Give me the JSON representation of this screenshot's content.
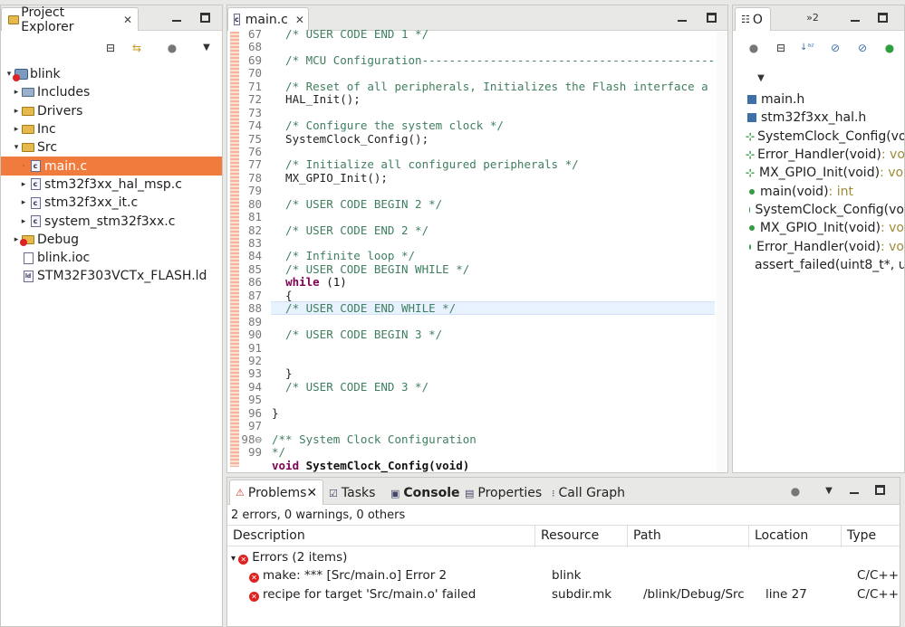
{
  "project_explorer": {
    "tab_label": "Project Explorer",
    "tree": [
      {
        "label": "blink",
        "indent": 0,
        "twisty": "▾",
        "kind": "project"
      },
      {
        "label": "Includes",
        "indent": 1,
        "twisty": "▸",
        "kind": "includes"
      },
      {
        "label": "Drivers",
        "indent": 1,
        "twisty": "▸",
        "kind": "folder"
      },
      {
        "label": "Inc",
        "indent": 1,
        "twisty": "▸",
        "kind": "folder"
      },
      {
        "label": "Src",
        "indent": 1,
        "twisty": "▾",
        "kind": "folder"
      },
      {
        "label": "main.c",
        "indent": 2,
        "twisty": "·",
        "kind": "cfile",
        "selected": true
      },
      {
        "label": "stm32f3xx_hal_msp.c",
        "indent": 2,
        "twisty": "▸",
        "kind": "cfile"
      },
      {
        "label": "stm32f3xx_it.c",
        "indent": 2,
        "twisty": "▸",
        "kind": "cfile"
      },
      {
        "label": "system_stm32f3xx.c",
        "indent": 2,
        "twisty": "▸",
        "kind": "cfile"
      },
      {
        "label": "Debug",
        "indent": 1,
        "twisty": "▸",
        "kind": "folder-error"
      },
      {
        "label": "blink.ioc",
        "indent": 1,
        "twisty": "",
        "kind": "file"
      },
      {
        "label": "STM32F303VCTx_FLASH.ld",
        "indent": 1,
        "twisty": "",
        "kind": "ldfile"
      }
    ]
  },
  "editor": {
    "tab_label": "main.c",
    "lines": [
      {
        "n": "67",
        "t": "  /* USER CODE END 1 */",
        "c": "cmt"
      },
      {
        "n": "68",
        "t": "",
        "c": ""
      },
      {
        "n": "69",
        "t": "  /* MCU Configuration----------------------------------------------",
        "c": "cmt"
      },
      {
        "n": "70",
        "t": "",
        "c": ""
      },
      {
        "n": "71",
        "t": "  /* Reset of all peripherals, Initializes the Flash interface a",
        "c": "cmt"
      },
      {
        "n": "72",
        "t": "  HAL_Init();",
        "c": ""
      },
      {
        "n": "73",
        "t": "",
        "c": ""
      },
      {
        "n": "74",
        "t": "  /* Configure the system clock */",
        "c": "cmt"
      },
      {
        "n": "75",
        "t": "  SystemClock_Config();",
        "c": ""
      },
      {
        "n": "76",
        "t": "",
        "c": ""
      },
      {
        "n": "77",
        "t": "  /* Initialize all configured peripherals */",
        "c": "cmt"
      },
      {
        "n": "78",
        "t": "  MX_GPIO_Init();",
        "c": ""
      },
      {
        "n": "79",
        "t": "",
        "c": ""
      },
      {
        "n": "80",
        "t": "  /* USER CODE BEGIN 2 */",
        "c": "cmt"
      },
      {
        "n": "81",
        "t": "",
        "c": ""
      },
      {
        "n": "82",
        "t": "  /* USER CODE END 2 */",
        "c": "cmt"
      },
      {
        "n": "83",
        "t": "",
        "c": ""
      },
      {
        "n": "84",
        "t": "  /* Infinite loop */",
        "c": "cmt"
      },
      {
        "n": "85",
        "t": "  /* USER CODE BEGIN WHILE */",
        "c": "cmt"
      },
      {
        "n": "86",
        "t": "  while (1)",
        "c": "while"
      },
      {
        "n": "87",
        "t": "  {",
        "c": ""
      },
      {
        "n": "88",
        "t": "  /* USER CODE END WHILE */",
        "c": "cmt",
        "highlight": true
      },
      {
        "n": "89",
        "t": "",
        "c": ""
      },
      {
        "n": "90",
        "t": "  /* USER CODE BEGIN 3 */",
        "c": "cmt"
      },
      {
        "n": "91",
        "t": "",
        "c": ""
      },
      {
        "n": "92",
        "t": "",
        "c": ""
      },
      {
        "n": "93",
        "t": "  }",
        "c": ""
      },
      {
        "n": "94",
        "t": "  /* USER CODE END 3 */",
        "c": "cmt"
      },
      {
        "n": "95",
        "t": "",
        "c": ""
      },
      {
        "n": "96",
        "t": "}",
        "c": ""
      },
      {
        "n": "97",
        "t": "",
        "c": ""
      },
      {
        "n": "98⊖",
        "t": "/** System Clock Configuration",
        "c": "cmt"
      },
      {
        "n": "99",
        "t": "*/",
        "c": "cmt"
      },
      {
        "n": "",
        "t": "void SystemClock_Config(void)",
        "c": "void"
      }
    ]
  },
  "outline": {
    "tab_label": "O",
    "overflow_label": "»2",
    "items": [
      {
        "label": "main.h",
        "icon": "header",
        "ret": ""
      },
      {
        "label": "stm32f3xx_hal.h",
        "icon": "header",
        "ret": ""
      },
      {
        "label": "SystemClock_Config(vo",
        "icon": "decl",
        "ret": ""
      },
      {
        "label": "Error_Handler(void)",
        "icon": "decl",
        "ret": " : vo"
      },
      {
        "label": "MX_GPIO_Init(void)",
        "icon": "decl-static",
        "ret": " : vo"
      },
      {
        "label": "main(void)",
        "icon": "fn",
        "ret": " : int"
      },
      {
        "label": "SystemClock_Config(vo",
        "icon": "fn",
        "ret": ""
      },
      {
        "label": "MX_GPIO_Init(void)",
        "icon": "fn-static",
        "ret": " : vo"
      },
      {
        "label": "Error_Handler(void)",
        "icon": "fn",
        "ret": " : vo"
      },
      {
        "label": "assert_failed(uint8_t*, u",
        "icon": "fn",
        "ret": ""
      }
    ]
  },
  "problems": {
    "tabs": [
      {
        "label": "Problems",
        "active": true
      },
      {
        "label": "Tasks"
      },
      {
        "label": "Console",
        "bold": true
      },
      {
        "label": "Properties"
      },
      {
        "label": "Call Graph"
      }
    ],
    "summary": "2 errors, 0 warnings, 0 others",
    "columns": [
      "Description",
      "Resource",
      "Path",
      "Location",
      "Type"
    ],
    "group_label": "Errors (2 items)",
    "rows": [
      {
        "description": "make: *** [Src/main.o] Error 2",
        "resource": "blink",
        "path": "",
        "location": "",
        "type": "C/C++ P"
      },
      {
        "description": "recipe for target 'Src/main.o' failed",
        "resource": "subdir.mk",
        "path": "/blink/Debug/Src",
        "location": "line 27",
        "type": "C/C++ P"
      }
    ]
  }
}
